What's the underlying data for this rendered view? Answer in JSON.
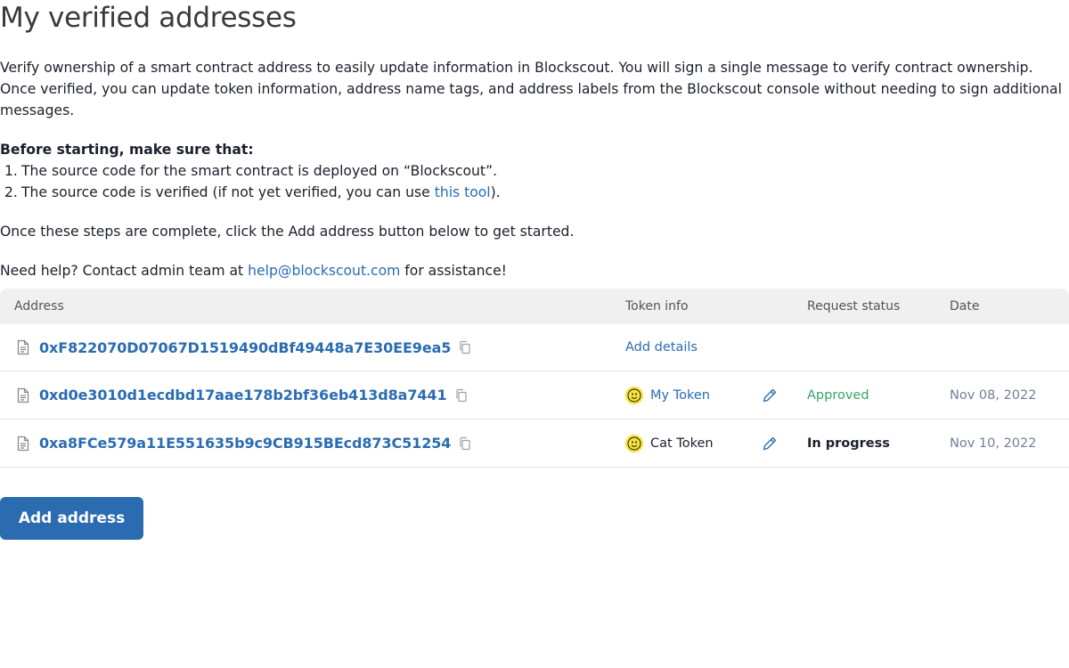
{
  "page": {
    "title": "My verified addresses"
  },
  "intro": {
    "paragraph": "Verify ownership of a smart contract address to easily update information in Blockscout. You will sign a single message to verify contract ownership. Once verified, you can update token information, address name tags, and address labels from the Blockscout console without needing to sign additional messages.",
    "before_heading": "Before starting, make sure that:",
    "steps": [
      {
        "num": "1.",
        "text": "The source code for the smart contract is deployed on “Blockscout”."
      },
      {
        "num": "2.",
        "text_before": "The source code is verified (if not yet verified, you can use ",
        "link": "this tool",
        "text_after": ")."
      }
    ],
    "complete_text": "Once these steps are complete, click the Add address button below to get started.",
    "help_before": "Need help? Contact admin team at ",
    "help_email": "help@blockscout.com",
    "help_after": " for assistance!"
  },
  "table": {
    "headers": {
      "address": "Address",
      "token_info": "Token info",
      "request_status": "Request status",
      "date": "Date"
    },
    "rows": [
      {
        "address": "0xF822070D07067D1519490dBf49448a7E30EE9ea5",
        "token_action": "Add details",
        "token_name": "",
        "status": "",
        "date": ""
      },
      {
        "address": "0xd0e3010d1ecdbd17aae178b2bf36eb413d8a7441",
        "token_action": "",
        "token_name": "My Token",
        "status": "Approved",
        "date": "Nov 08, 2022"
      },
      {
        "address": "0xa8FCe579a11E551635b9c9CB915BEcd873C51254",
        "token_action": "",
        "token_name": "Cat Token",
        "status": "In progress",
        "date": "Nov 10, 2022"
      }
    ]
  },
  "actions": {
    "add_address_label": "Add address"
  },
  "colors": {
    "link": "#2b6cb0",
    "approved": "#38a169",
    "header_bg": "#f0f0f0",
    "token_avatar": "#f5e23a"
  },
  "icons": {
    "address": "file-icon",
    "copy": "copy-icon",
    "edit": "pencil-icon",
    "token": "token-avatar-icon"
  }
}
